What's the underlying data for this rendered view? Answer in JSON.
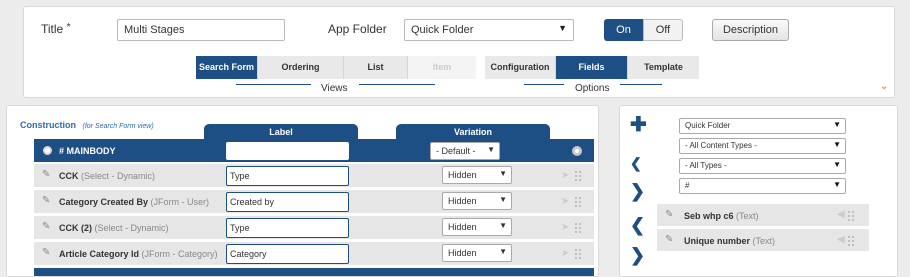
{
  "form": {
    "title_label": "Title",
    "title_required": "*",
    "title_value": "Multi Stages",
    "app_folder_label": "App Folder",
    "app_folder_value": "Quick Folder",
    "on_label": "On",
    "off_label": "Off",
    "description_label": "Description"
  },
  "views": {
    "group_label": "Views",
    "tabs": [
      "Search Form",
      "Ordering",
      "List",
      "Item"
    ],
    "active": "Search Form"
  },
  "options": {
    "group_label": "Options",
    "tabs": [
      "Configuration",
      "Fields",
      "Template"
    ],
    "active": "Fields"
  },
  "construction": {
    "title": "Construction",
    "subtitle": "(for Search Form view)",
    "col_label": "Label",
    "col_variation": "Variation",
    "head_row": {
      "name": "# MAINBODY",
      "label_value": "",
      "variation": "- Default -"
    },
    "rows": [
      {
        "name": "CCK",
        "type": "(Select - Dynamic)",
        "label_value": "Type",
        "variation": "Hidden"
      },
      {
        "name": "Category Created By",
        "type": "(JForm - User)",
        "label_value": "Created by",
        "variation": "Hidden"
      },
      {
        "name": "CCK (2)",
        "type": "(Select - Dynamic)",
        "label_value": "Type",
        "variation": "Hidden"
      },
      {
        "name": "Article Category Id",
        "type": "(JForm - Category)",
        "label_value": "Category",
        "variation": "Hidden"
      }
    ]
  },
  "filters": {
    "folder": "Quick Folder",
    "content_types": "- All Content Types -",
    "types": "- All Types -",
    "sort": "#"
  },
  "available_fields": [
    {
      "name": "Seb whp c6",
      "type": "(Text)"
    },
    {
      "name": "Unique number",
      "type": "(Text)"
    }
  ],
  "colors": {
    "accent": "#1d4f85",
    "toggle_arrow": "#f0a030"
  }
}
